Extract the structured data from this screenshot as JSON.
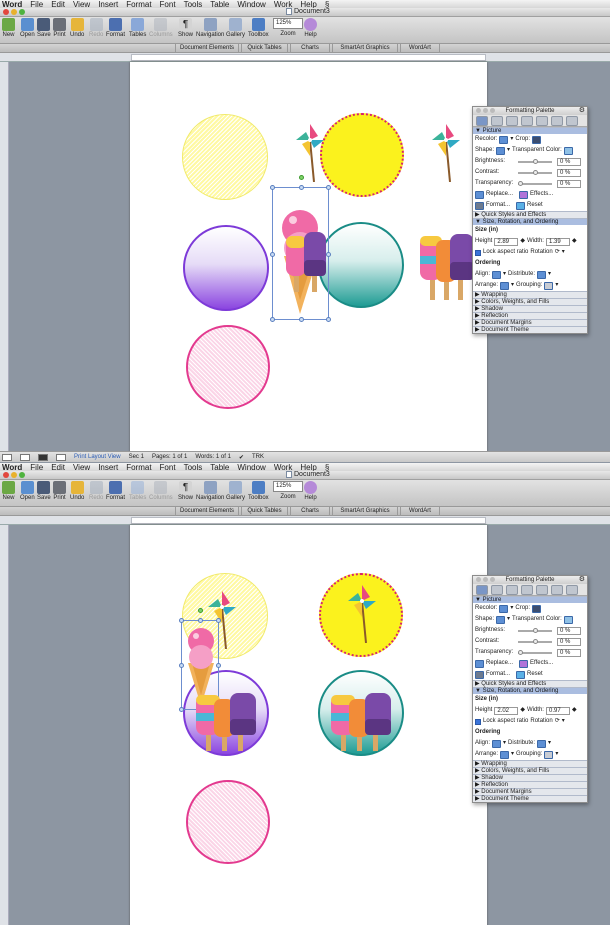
{
  "menubar": {
    "app": "Word",
    "items": [
      "File",
      "Edit",
      "View",
      "Insert",
      "Format",
      "Font",
      "Tools",
      "Table",
      "Window",
      "Work",
      "Help"
    ]
  },
  "window": {
    "title": "Document3"
  },
  "toolbar": {
    "new": "New",
    "open": "Open",
    "save": "Save",
    "print": "Print",
    "undo": "Undo",
    "redo": "Redo",
    "format": "Format",
    "tables": "Tables",
    "columns": "Columns",
    "show": "Show",
    "navigation": "Navigation",
    "gallery": "Gallery",
    "toolbox": "Toolbox",
    "zoom_label": "Zoom",
    "help": "Help",
    "zoom_value": "125%"
  },
  "ribbon_tabs": [
    "Document Elements",
    "Quick Tables",
    "Charts",
    "SmartArt Graphics",
    "WordArt"
  ],
  "palette": {
    "title": "Formatting Palette",
    "picture": "Picture",
    "recolor": "Recolor:",
    "crop": "Crop:",
    "shape": "Shape:",
    "transparent": "Transparent Color:",
    "brightness": "Brightness:",
    "contrast": "Contrast:",
    "transparency": "Transparency:",
    "pct": "0 %",
    "replace": "Replace...",
    "effects": "Effects...",
    "format": "Format...",
    "reset": "Reset",
    "quick_styles": "Quick Styles and Effects",
    "size_rot": "Size, Rotation, and Ordering",
    "size_in": "Size (in)",
    "height_label": "Height",
    "width_label": "Width:",
    "lock": "Lock aspect ratio",
    "rotation": "Rotation",
    "ordering": "Ordering",
    "align": "Align:",
    "distribute": "Distribute:",
    "arrange": "Arrange:",
    "grouping": "Grouping:",
    "wrapping": "Wrapping",
    "colors": "Colors, Weights, and Fills",
    "shadow": "Shadow",
    "reflection": "Reflection",
    "doc_margins": "Document Margins",
    "doc_theme": "Document Theme"
  },
  "screens": [
    {
      "height": "2.89",
      "width": "1.39"
    },
    {
      "height": "2.02",
      "width": "0.97"
    }
  ],
  "statusbar": {
    "view": "Print Layout View",
    "sec_label": "Sec",
    "sec_val": "1",
    "pages_label": "Pages:",
    "pages_val": "1 of 1",
    "words_label": "Words:",
    "words_val": "1 of 1",
    "trk": "TRK"
  },
  "colors": {
    "hatch_yellow": "#fff9a3",
    "yellow": "#fbf21d",
    "purple": "#8b45e0",
    "teal": "#1f9c94",
    "pink": "#e33a8f"
  }
}
